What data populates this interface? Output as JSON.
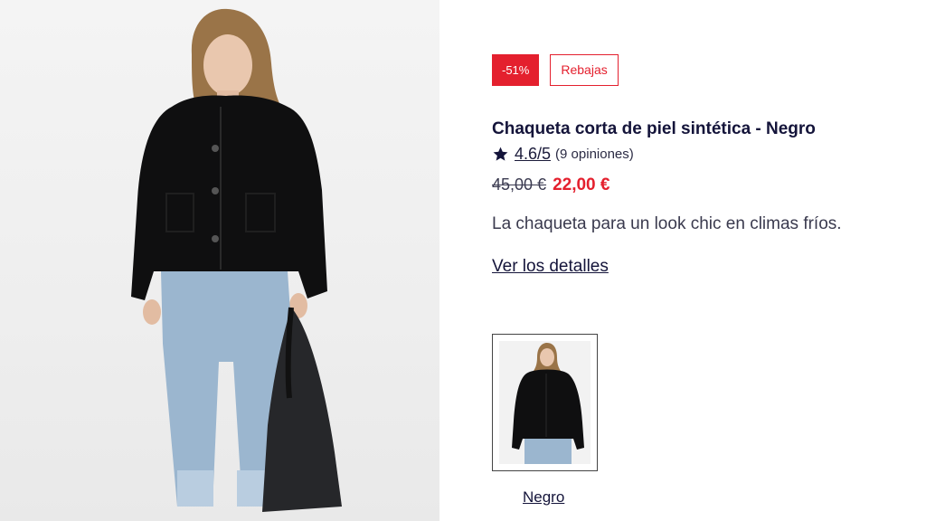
{
  "product": {
    "badges": {
      "discount": "-51%",
      "sale": "Rebajas"
    },
    "title": "Chaqueta corta de piel sintética - Negro",
    "rating": {
      "score": "4.6/5",
      "count": "(9 opiniones)",
      "icon": "star-icon"
    },
    "price": {
      "old": "45,00 €",
      "current": "22,00 €"
    },
    "description": "La chaqueta para un look chic en climas fríos.",
    "details_link": "Ver los detalles",
    "color_options": [
      {
        "label": "Negro"
      }
    ]
  },
  "colors": {
    "accent_red": "#e4202e",
    "text_navy": "#14143a"
  }
}
